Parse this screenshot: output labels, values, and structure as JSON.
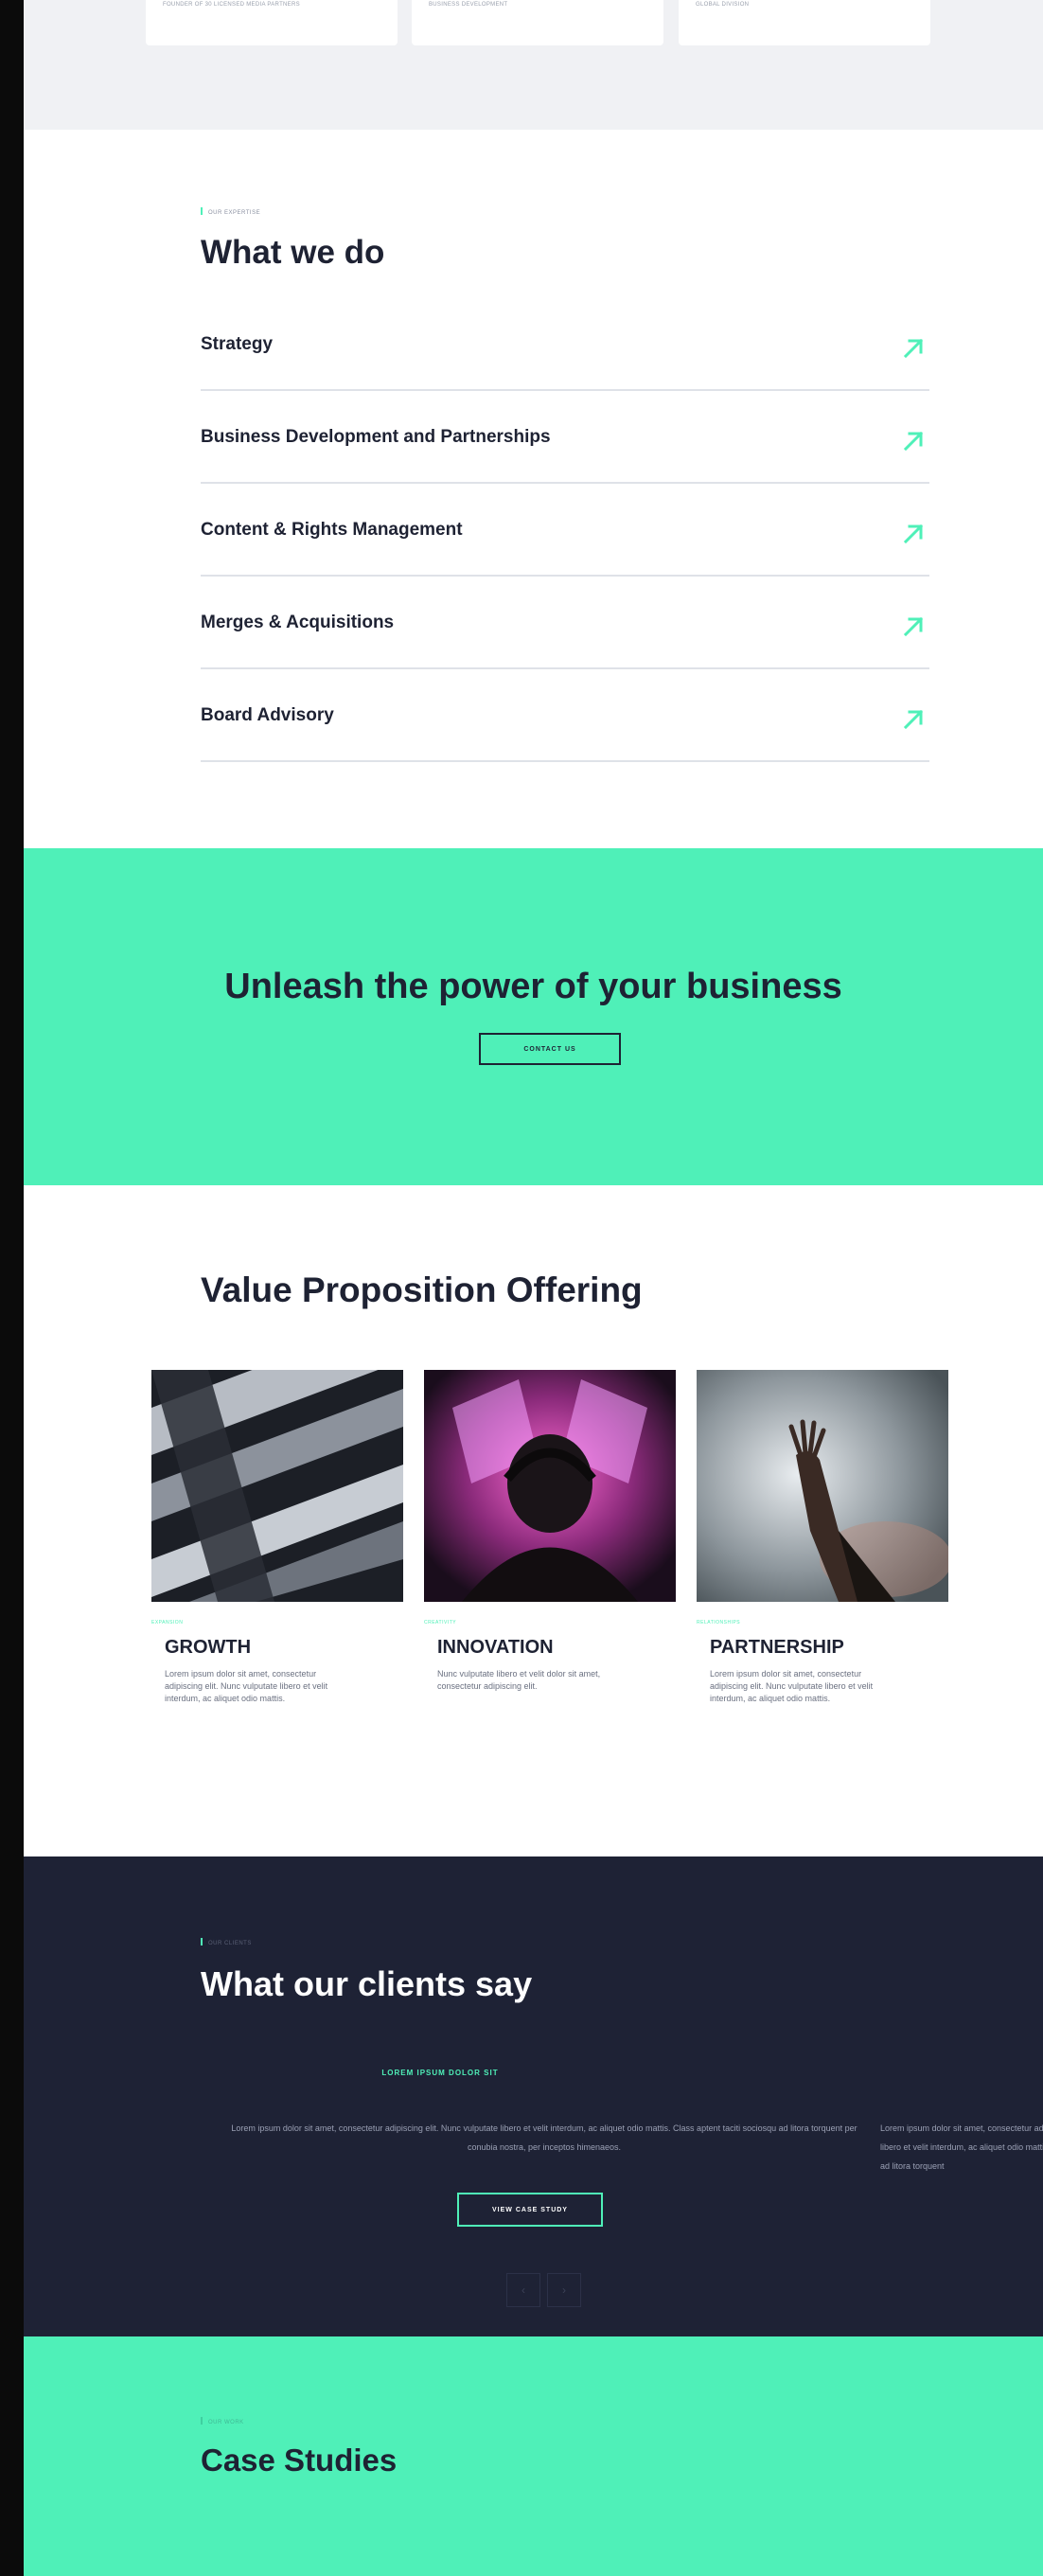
{
  "top_cards": [
    {
      "text": "FOUNDER OF 30 LICENSED MEDIA PARTNERS"
    },
    {
      "text": "BUSINESS DEVELOPMENT"
    },
    {
      "text": "GLOBAL DIVISION"
    }
  ],
  "expertise": {
    "eyebrow": "OUR EXPERTISE",
    "title": "What we do",
    "items": [
      {
        "label": "Strategy"
      },
      {
        "label": "Business Development and Partnerships"
      },
      {
        "label": "Content & Rights Management"
      },
      {
        "label": "Merges & Acquisitions"
      },
      {
        "label": "Board Advisory"
      }
    ],
    "arrow_icon": "arrow-up-right-icon",
    "accent": "#4ff0b8"
  },
  "cta": {
    "title": "Unleash the power of your business",
    "button": "CONTACT US"
  },
  "value": {
    "title": "Value Proposition Offering",
    "cards": [
      {
        "tag": "EXPANSION",
        "title": "GROWTH",
        "desc": "Lorem ipsum dolor sit amet, consectetur adipiscing elit. Nunc vulputate libero et velit interdum, ac aliquet odio mattis."
      },
      {
        "tag": "CREATIVITY",
        "title": "INNOVATION",
        "desc": "Nunc vulputate libero et velit dolor sit amet, consectetur adipiscing elit."
      },
      {
        "tag": "RELATIONSHIPS",
        "title": "PARTNERSHIP",
        "desc": "Lorem ipsum dolor sit amet, consectetur adipiscing elit. Nunc vulputate libero et velit interdum, ac aliquet odio mattis."
      }
    ]
  },
  "testimonials": {
    "eyebrow": "OUR CLIENTS",
    "title": "What our clients say",
    "quote_title": "LOREM IPSUM DOLOR SIT",
    "quote_text": "Lorem ipsum dolor sit amet, consectetur adipiscing elit. Nunc vulputate libero et velit interdum, ac aliquet odio mattis. Class aptent taciti sociosqu ad litora torquent per conubia nostra, per inceptos himenaeos.",
    "quote_text_next": "Lorem ipsum dolor sit amet, consectetur adipiscing elit. Nunc vulputate libero et velit interdum, ac aliquet odio mattis. Class aptent taciti sociosqu ad litora torquent",
    "button": "VIEW CASE STUDY",
    "prev_icon": "chevron-left-icon",
    "next_icon": "chevron-right-icon",
    "prev_glyph": "‹",
    "next_glyph": "›"
  },
  "case_studies": {
    "eyebrow": "OUR WORK",
    "title": "Case Studies"
  }
}
